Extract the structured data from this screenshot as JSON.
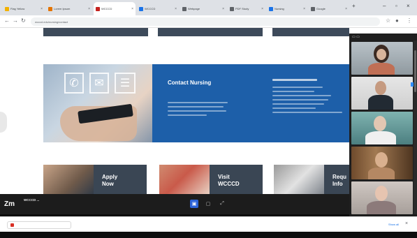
{
  "browser": {
    "tabs": [
      {
        "label": "Flag Yellow",
        "color": "#f2b100",
        "active": false
      },
      {
        "label": "Lorem Ipsum",
        "color": "#e37400",
        "active": false
      },
      {
        "label": "WCCCD",
        "color": "#c5221f",
        "active": true
      },
      {
        "label": "WCCCD",
        "color": "#1a73e8",
        "active": false
      },
      {
        "label": "Webpage",
        "color": "#5f6368",
        "active": false
      },
      {
        "label": "PDF Study",
        "color": "#5f6368",
        "active": false
      },
      {
        "label": "Nursing",
        "color": "#1a73e8",
        "active": false
      },
      {
        "label": "Google",
        "color": "#5f6368",
        "active": false
      }
    ],
    "url": "wcccd.edu/nursing/contact"
  },
  "page": {
    "contact_title": "Contact Nursing",
    "tiles": [
      {
        "line1": "Apply",
        "line2": "Now"
      },
      {
        "line1": "Visit",
        "line2": "WCCCD"
      },
      {
        "line1": "Requ",
        "line2": "Info"
      }
    ]
  },
  "meeting": {
    "logo": "Zm",
    "title": "WCCCD ...",
    "subtitle": ""
  },
  "downloads": {
    "file_label": "",
    "show_all": "Show all"
  },
  "colors": {
    "page_blue": "#1d5fa9",
    "tile_slate": "#3a4654",
    "meeting_bar": "#1c1c1c"
  }
}
